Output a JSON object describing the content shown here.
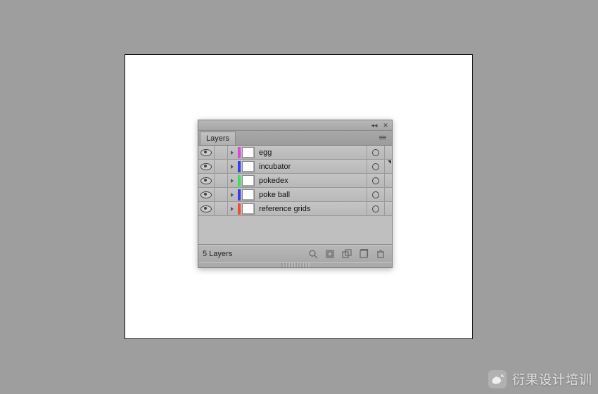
{
  "panel": {
    "tab_label": "Layers",
    "status": "5 Layers",
    "layers": [
      {
        "name": "egg",
        "color": "#d948d9",
        "selected": false
      },
      {
        "name": "incubator",
        "color": "#3a3af2",
        "selected": true
      },
      {
        "name": "pokedex",
        "color": "#38e25a",
        "selected": false
      },
      {
        "name": "poke ball",
        "color": "#3a3af2",
        "selected": false
      },
      {
        "name": "reference grids",
        "color": "#f24a3a",
        "selected": false
      }
    ]
  },
  "watermark": {
    "text": "衍果设计培训"
  }
}
